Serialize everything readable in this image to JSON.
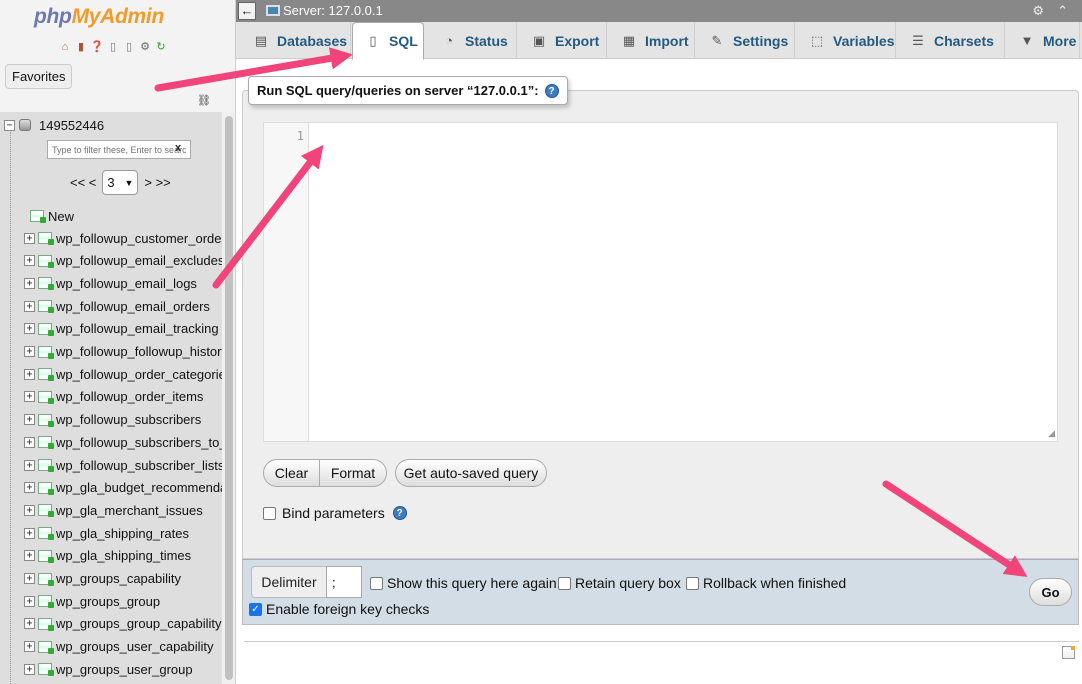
{
  "app": {
    "logo_part1": "php",
    "logo_part2": "MyAdmin",
    "favorites_label": "Favorites"
  },
  "nav_icons": [
    "home-icon",
    "logout-icon",
    "help-icon",
    "docs-icon",
    "copy-icon",
    "settings-icon",
    "reload-icon"
  ],
  "tree": {
    "database": "149552446",
    "filter_placeholder": "Type to filter these, Enter to search",
    "pager_prev": "<< <",
    "pager_page": "3",
    "pager_next": "> >>",
    "new_label": "New",
    "tables": [
      "wp_followup_customer_orders",
      "wp_followup_email_excludes",
      "wp_followup_email_logs",
      "wp_followup_email_orders",
      "wp_followup_email_tracking",
      "wp_followup_followup_history",
      "wp_followup_order_categories",
      "wp_followup_order_items",
      "wp_followup_subscribers",
      "wp_followup_subscribers_to_lists",
      "wp_followup_subscriber_lists",
      "wp_gla_budget_recommendations",
      "wp_gla_merchant_issues",
      "wp_gla_shipping_rates",
      "wp_gla_shipping_times",
      "wp_groups_capability",
      "wp_groups_group",
      "wp_groups_group_capability",
      "wp_groups_user_capability",
      "wp_groups_user_group"
    ]
  },
  "topbar": {
    "back": "←",
    "server": "Server: 127.0.0.1"
  },
  "tabs": [
    {
      "label": "Databases",
      "icon": "database-icon",
      "glyph": "▤"
    },
    {
      "label": "SQL",
      "icon": "sql-icon",
      "glyph": "▯"
    },
    {
      "label": "Status",
      "icon": "status-icon",
      "glyph": "◔"
    },
    {
      "label": "Export",
      "icon": "export-icon",
      "glyph": "▣"
    },
    {
      "label": "Import",
      "icon": "import-icon",
      "glyph": "▦"
    },
    {
      "label": "Settings",
      "icon": "wrench-icon",
      "glyph": "✎"
    },
    {
      "label": "Variables",
      "icon": "variables-icon",
      "glyph": "⬚"
    },
    {
      "label": "Charsets",
      "icon": "charsets-icon",
      "glyph": "☰"
    },
    {
      "label": "More",
      "icon": "more-icon",
      "glyph": "▼"
    }
  ],
  "sql": {
    "legend": "Run SQL query/queries on server “127.0.0.1”:",
    "line_number": "1",
    "clear": "Clear",
    "format": "Format",
    "autosave": "Get auto-saved query",
    "bind_parameters": "Bind parameters"
  },
  "options": {
    "delimiter_label": "Delimiter",
    "delimiter_value": ";",
    "show_query": "Show this query here again",
    "retain_box": "Retain query box",
    "rollback": "Rollback when finished",
    "foreign_keys": "Enable foreign key checks",
    "go": "Go"
  },
  "colors": {
    "arrow": "#f0447a",
    "tab_text": "#235a81",
    "checkbox_checked": "#1a73e8"
  }
}
